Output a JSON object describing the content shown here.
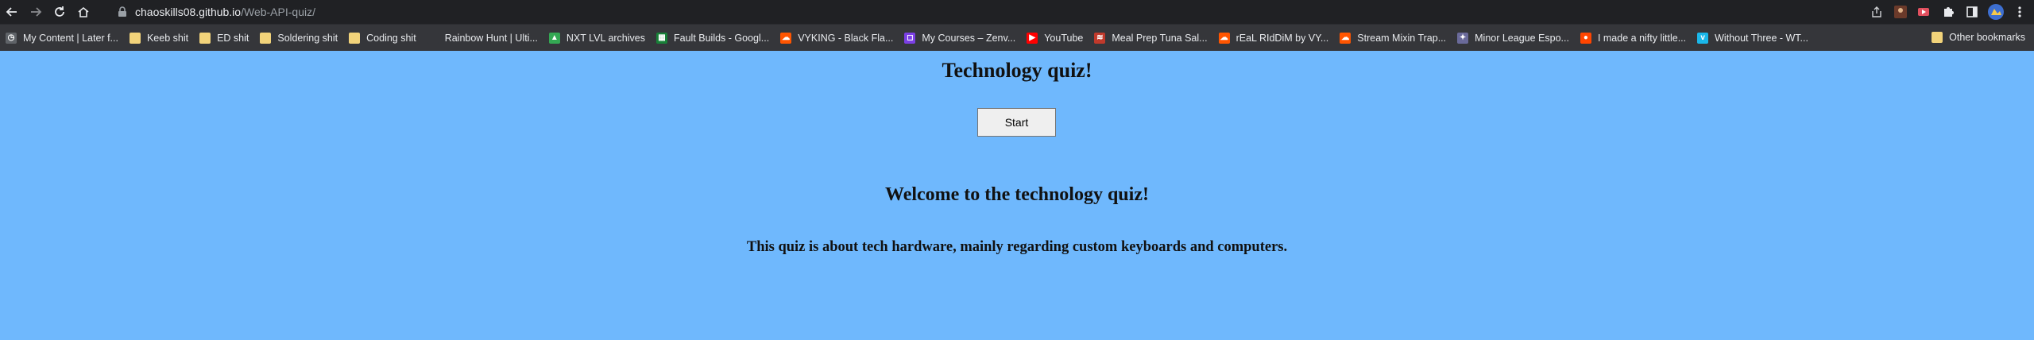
{
  "browser": {
    "url_host": "chaoskills08.github.io",
    "url_path": "/Web-API-quiz/"
  },
  "bookmarks": [
    {
      "label": "My Content | Later f...",
      "icon": "later-icon",
      "color": "#5f6368"
    },
    {
      "label": "Keeb shit",
      "icon": "folder-icon",
      "color": "#f2d37a"
    },
    {
      "label": "ED shit",
      "icon": "folder-icon",
      "color": "#f2d37a"
    },
    {
      "label": "Soldering shit",
      "icon": "folder-icon",
      "color": "#f2d37a"
    },
    {
      "label": "Coding shit",
      "icon": "folder-icon",
      "color": "#f2d37a"
    },
    {
      "label": "Rainbow Hunt | Ulti...",
      "icon": "blank-icon",
      "color": "#35363a"
    },
    {
      "label": "NXT LVL archives",
      "icon": "drive-icon",
      "color": "#34a853"
    },
    {
      "label": "Fault Builds - Googl...",
      "icon": "sheets-icon",
      "color": "#188038"
    },
    {
      "label": "VYKING - Black Fla...",
      "icon": "soundcloud-icon",
      "color": "#ff5500"
    },
    {
      "label": "My Courses – Zenv...",
      "icon": "zenva-icon",
      "color": "#7b3fe4"
    },
    {
      "label": "YouTube",
      "icon": "youtube-icon",
      "color": "#ff0000"
    },
    {
      "label": "Meal Prep Tuna Sal...",
      "icon": "recipe-icon",
      "color": "#c0392b"
    },
    {
      "label": "rEaL RIdDiM by VY...",
      "icon": "soundcloud-icon",
      "color": "#ff5500"
    },
    {
      "label": "Stream Mixin Trap...",
      "icon": "soundcloud-icon",
      "color": "#ff5500"
    },
    {
      "label": "Minor League Espo...",
      "icon": "mle-icon",
      "color": "#6a6a9a"
    },
    {
      "label": "I made a nifty little...",
      "icon": "reddit-icon",
      "color": "#ff4500"
    },
    {
      "label": "Without Three - WT...",
      "icon": "vimeo-icon",
      "color": "#1ab7ea"
    }
  ],
  "other_bookmarks": "Other bookmarks",
  "page": {
    "title": "Technology quiz!",
    "start_label": "Start",
    "welcome": "Welcome to the technology quiz!",
    "description": "This quiz is about tech hardware, mainly regarding custom keyboards and computers."
  },
  "colors": {
    "page_background": "#6fb8fd",
    "chrome_dark": "#202124",
    "bookmark_bar": "#35363a"
  }
}
